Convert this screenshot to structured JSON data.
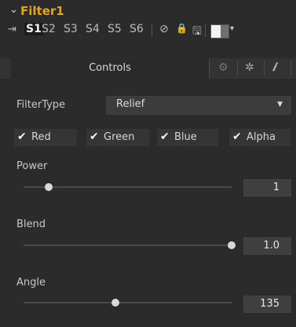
{
  "header": {
    "chevron": "⌄",
    "title": "Filter1"
  },
  "toolbar": {
    "pin_icon": "⇥",
    "slots": [
      "S1",
      "S2",
      "S3",
      "S4",
      "S5",
      "S6"
    ],
    "active_slot": "S1",
    "icons": {
      "disable": "⊘",
      "lock": "🔒",
      "save": "🖫"
    }
  },
  "tabs": {
    "controls": "Controls",
    "icons": [
      "settings-icon",
      "gear-icon",
      "info-icon"
    ]
  },
  "filter_type": {
    "label": "FilterType",
    "value": "Relief"
  },
  "channels": [
    {
      "label": "Red",
      "checked": true
    },
    {
      "label": "Green",
      "checked": true
    },
    {
      "label": "Blue",
      "checked": true
    },
    {
      "label": "Alpha",
      "checked": true
    }
  ],
  "power": {
    "label": "Power",
    "value": "1",
    "level": 0.12
  },
  "blend": {
    "label": "Blend",
    "value": "1.0",
    "level": 1.0
  },
  "angle": {
    "label": "Angle",
    "value": "135",
    "level": 0.44
  }
}
